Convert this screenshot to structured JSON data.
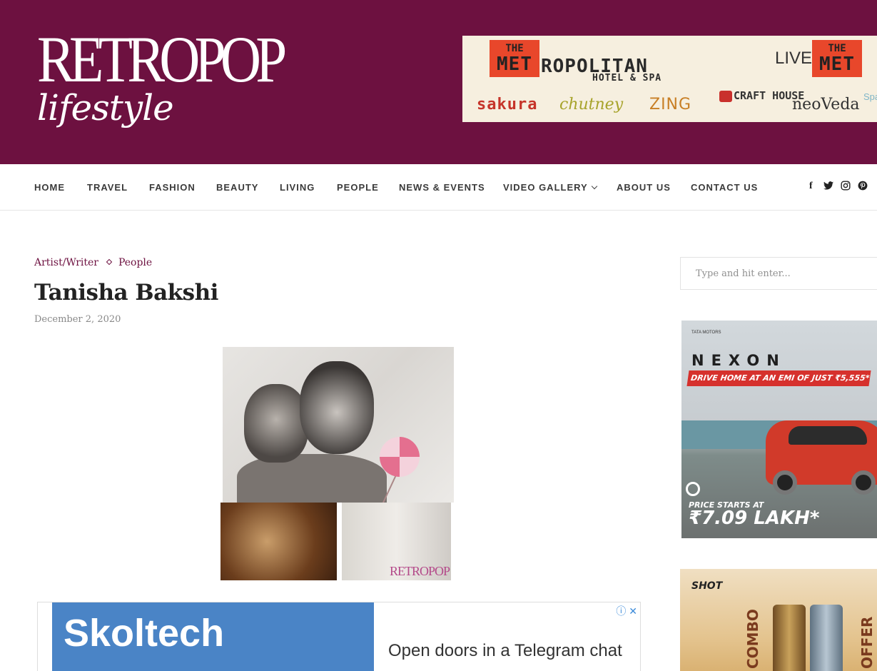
{
  "site": {
    "logo_main": "RETROPOP",
    "logo_sub": "lifestyle"
  },
  "header_ad": {
    "met_the": "THE",
    "met_met": "MET",
    "name": "ROPOLITAN",
    "subtitle": "HOTEL & SPA",
    "live": "LIVE",
    "brands": [
      "sakura",
      "chutney",
      "ZING",
      "CRAFT HOUSE",
      "neoVeda",
      "Spa"
    ]
  },
  "nav": {
    "items": [
      "HOME",
      "TRAVEL",
      "FASHION",
      "BEAUTY",
      "LIVING",
      "PEOPLE",
      "NEWS & EVENTS",
      "VIDEO GALLERY",
      "ABOUT US",
      "CONTACT US"
    ],
    "social": [
      "f",
      "t",
      "◎",
      "℗"
    ]
  },
  "post": {
    "categories": [
      "Artist/Writer",
      "People"
    ],
    "title": "Tanisha Bakshi",
    "date": "December 2, 2020",
    "watermark": "RETROPOP"
  },
  "bottom_ad": {
    "title": "Skoltech",
    "text": "Open doors in a Telegram chat",
    "choices": "ⓘ ✕"
  },
  "sidebar": {
    "search_placeholder": "Type and hit enter...",
    "nexon": {
      "brand": "TATA MOTORS",
      "title": "NEXON",
      "strip": "DRIVE HOME AT AN EMI OF JUST ₹5,555*",
      "price_label": "PRICE STARTS AT",
      "price": "₹7.09 LAKH*"
    },
    "shot": {
      "logo": "SHOT",
      "combo": "COMBO",
      "offer": "OFFER"
    }
  }
}
